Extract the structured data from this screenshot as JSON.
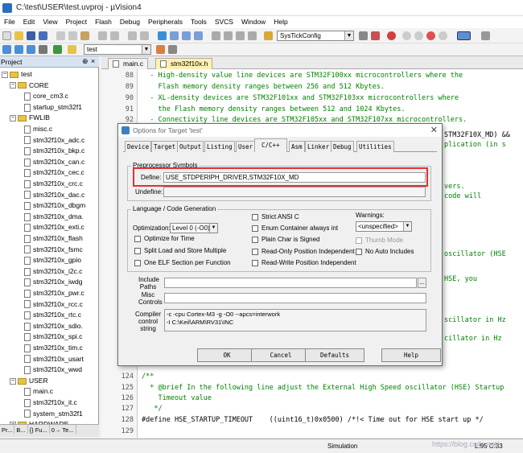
{
  "window": {
    "title": "C:\\test\\USER\\test.uvproj - µVision4"
  },
  "menu": [
    "File",
    "Edit",
    "View",
    "Project",
    "Flash",
    "Debug",
    "Peripherals",
    "Tools",
    "SVCS",
    "Window",
    "Help"
  ],
  "toolbar": {
    "func_combo": "SysTickConfig",
    "target_combo": "test"
  },
  "project": {
    "header": "Project",
    "root": "test",
    "rows": [
      {
        "kind": "folder",
        "label": "CORE",
        "indent": 1
      },
      {
        "kind": "file",
        "label": "core_cm3.c",
        "indent": 2
      },
      {
        "kind": "file",
        "label": "startup_stm32f1",
        "indent": 2
      },
      {
        "kind": "folder",
        "label": "FWLIB",
        "indent": 1
      },
      {
        "kind": "file",
        "label": "misc.c",
        "indent": 2
      },
      {
        "kind": "file",
        "label": "stm32f10x_adc.c",
        "indent": 2
      },
      {
        "kind": "file",
        "label": "stm32f10x_bkp.c",
        "indent": 2
      },
      {
        "kind": "file",
        "label": "stm32f10x_can.c",
        "indent": 2
      },
      {
        "kind": "file",
        "label": "stm32f10x_cec.c",
        "indent": 2
      },
      {
        "kind": "file",
        "label": "stm32f10x_crc.c",
        "indent": 2
      },
      {
        "kind": "file",
        "label": "stm32f10x_dac.c",
        "indent": 2
      },
      {
        "kind": "file",
        "label": "stm32f10x_dbgm",
        "indent": 2
      },
      {
        "kind": "file",
        "label": "stm32f10x_dma.",
        "indent": 2
      },
      {
        "kind": "file",
        "label": "stm32f10x_exti.c",
        "indent": 2
      },
      {
        "kind": "file",
        "label": "stm32f10x_flash",
        "indent": 2
      },
      {
        "kind": "file",
        "label": "stm32f10x_fsmc",
        "indent": 2
      },
      {
        "kind": "file",
        "label": "stm32f10x_gpio",
        "indent": 2
      },
      {
        "kind": "file",
        "label": "stm32f10x_i2c.c",
        "indent": 2
      },
      {
        "kind": "file",
        "label": "stm32f10x_iwdg",
        "indent": 2
      },
      {
        "kind": "file",
        "label": "stm32f10x_pwr.c",
        "indent": 2
      },
      {
        "kind": "file",
        "label": "stm32f10x_rcc.c",
        "indent": 2
      },
      {
        "kind": "file",
        "label": "stm32f10x_rtc.c",
        "indent": 2
      },
      {
        "kind": "file",
        "label": "stm32f10x_sdio.",
        "indent": 2
      },
      {
        "kind": "file",
        "label": "stm32f10x_spi.c",
        "indent": 2
      },
      {
        "kind": "file",
        "label": "stm32f10x_tim.c",
        "indent": 2
      },
      {
        "kind": "file",
        "label": "stm32f10x_usart",
        "indent": 2
      },
      {
        "kind": "file",
        "label": "stm32f10x_wwd",
        "indent": 2
      },
      {
        "kind": "folder",
        "label": "USER",
        "indent": 1
      },
      {
        "kind": "file",
        "label": "main.c",
        "indent": 2
      },
      {
        "kind": "file",
        "label": "stm32f10x_it.c",
        "indent": 2
      },
      {
        "kind": "file",
        "label": "system_stm32f1",
        "indent": 2
      },
      {
        "kind": "folder",
        "label": "HARDWARE",
        "indent": 1
      }
    ],
    "bottom_tabs": [
      "Pr...",
      "B...",
      "{} Fu...",
      "0→ Te..."
    ]
  },
  "editor": {
    "tabs": [
      "main.c",
      "stm32f10x.h"
    ],
    "lines": [
      {
        "n": "88",
        "t": "  - High-density value line devices are STM32F100xx microcontrollers where the",
        "c": "cm"
      },
      {
        "n": "89",
        "t": "    Flash memory density ranges between 256 and 512 Kbytes.",
        "c": "cm"
      },
      {
        "n": "90",
        "t": "  - XL-density devices are STM32F101xx and STM32F103xx microcontrollers where",
        "c": "cm"
      },
      {
        "n": "91",
        "t": "    the Flash memory density ranges between 512 and 1024 Kbytes.",
        "c": "cm"
      },
      {
        "n": "92",
        "t": "  - Connectivity line devices are STM32F105xx and STM32F107xx microcontrollers.",
        "c": "cm"
      },
      {
        "n": "93",
        "t": "  */",
        "c": "cm"
      },
      {
        "n": "124",
        "t": "/**",
        "c": "cm"
      },
      {
        "n": "125",
        "t": "  * @brief In the following line adjust the External High Speed oscillator (HSE) Startup",
        "c": "cm"
      },
      {
        "n": "126",
        "t": "    Timeout value",
        "c": "cm"
      },
      {
        "n": "127",
        "t": "   */",
        "c": "cm"
      },
      {
        "n": "128",
        "t": "#define HSE_STARTUP_TIMEOUT    ((uint16_t)0x0500) /*!< Time out for HSE start up */",
        "c": "code"
      },
      {
        "n": "129",
        "t": "",
        "c": "code"
      }
    ],
    "peek": [
      "STM32F10X_MD) &&",
      "plication (in s",
      "vers.",
      "code will",
      "oscillator (HSE",
      "HSE, you",
      "scillator in Hz",
      "cillator in Hz"
    ]
  },
  "status": {
    "mode": "Simulation",
    "pos": "L:95 C:33"
  },
  "watermark": "https://blog.csdn.net/",
  "dialog": {
    "title": "Options for Target 'test'",
    "tabs": [
      "Device",
      "Target",
      "Output",
      "Listing",
      "User",
      "C/C++",
      "Asm",
      "Linker",
      "Debug",
      "Utilities"
    ],
    "active_tab": "C/C++",
    "preproc_group": "Preprocessor Symbols",
    "define_label": "Define:",
    "define_value": "USE_STDPERIPH_DRIVER,STM32F10X_MD",
    "undefine_label": "Undefine:",
    "undefine_value": "",
    "lang_group": "Language / Code Generation",
    "optimization_label": "Optimization:",
    "optimization_value": "Level 0 (-O0)",
    "checks_left": [
      "Optimize for Time",
      "Split Load and Store Multiple",
      "One ELF Section per Function"
    ],
    "checks_mid": [
      "Strict ANSI C",
      "Enum Container always int",
      "Plain Char is Signed",
      "Read-Only Position Independent",
      "Read-Write Position Independent"
    ],
    "warnings_label": "Warnings:",
    "warnings_value": "<unspecified>",
    "thumb_mode": "Thumb Mode",
    "no_auto": "No Auto Includes",
    "include_label": "Include Paths",
    "misc_label": "Misc Controls",
    "compiler_label": "Compiler control string",
    "compiler_line1": "-c -cpu Cortex-M3 -g -O0 --apcs=interwork",
    "compiler_line2": "-I C:\\Keil\\ARM\\RV31\\INC",
    "buttons": [
      "OK",
      "Cancel",
      "Defaults",
      "Help"
    ]
  }
}
